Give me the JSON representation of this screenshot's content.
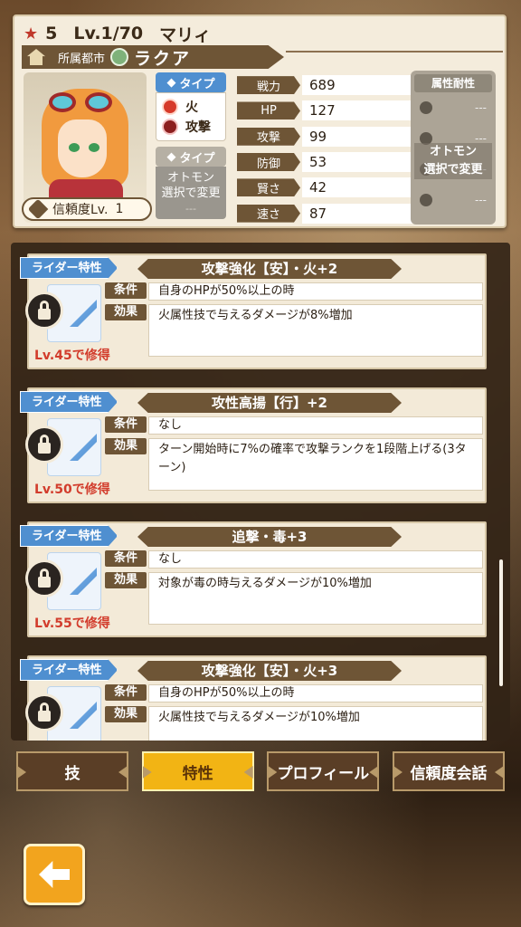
{
  "character": {
    "rarity": "5",
    "level": "Lv.1/70",
    "name": "マリィ",
    "city_label": "所属都市",
    "city_name": "ラクア",
    "trust_label": "信頼度Lv.",
    "trust_level": "1"
  },
  "type_panel": {
    "type_label": "タイプ",
    "element": "火",
    "style": "攻撃",
    "otomon_type_label": "タイプ",
    "otomon_text_line1": "オトモン",
    "otomon_text_line2": "選択で変更",
    "otomon_dash": "---"
  },
  "stats": [
    {
      "label": "戦力",
      "value": "689"
    },
    {
      "label": "HP",
      "value": "127"
    },
    {
      "label": "攻撃",
      "value": "99"
    },
    {
      "label": "防御",
      "value": "53"
    },
    {
      "label": "賢さ",
      "value": "42"
    },
    {
      "label": "速さ",
      "value": "87"
    }
  ],
  "resistance": {
    "title": "属性耐性",
    "dash": "---",
    "note_line1": "オトモン",
    "note_line2": "選択で変更"
  },
  "traits": [
    {
      "rider_label": "ライダー特性",
      "name": "攻撃強化【安】・火+2",
      "cond_label": "条件",
      "condition": "自身のHPが50%以上の時",
      "eff_label": "効果",
      "effect": "火属性技で与えるダメージが8%増加",
      "requirement": "Lv.45で修得"
    },
    {
      "rider_label": "ライダー特性",
      "name": "攻性高揚【行】+2",
      "cond_label": "条件",
      "condition": "なし",
      "eff_label": "効果",
      "effect": "ターン開始時に7%の確率で攻撃ランクを1段階上げる(3ターン)",
      "requirement": "Lv.50で修得"
    },
    {
      "rider_label": "ライダー特性",
      "name": "追撃・毒+3",
      "cond_label": "条件",
      "condition": "なし",
      "eff_label": "効果",
      "effect": "対象が毒の時与えるダメージが10%増加",
      "requirement": "Lv.55で修得"
    },
    {
      "rider_label": "ライダー特性",
      "name": "攻撃強化【安】・火+3",
      "cond_label": "条件",
      "condition": "自身のHPが50%以上の時",
      "eff_label": "効果",
      "effect": "火属性技で与えるダメージが10%増加",
      "requirement": ""
    }
  ],
  "tabs": [
    {
      "label": "技",
      "active": false
    },
    {
      "label": "特性",
      "active": true
    },
    {
      "label": "プロフィール",
      "active": false
    },
    {
      "label": "信頼度会話",
      "active": false
    }
  ],
  "colors": {
    "accent_blue": "#4f8fd0",
    "active_tab": "#f2b414",
    "panel_brown": "#6e5536",
    "locked_text": "#d23c2c"
  },
  "icons": {
    "rarity": "star-icon",
    "element": "fire-icon",
    "style": "attack-icon",
    "back": "back-arrow-icon"
  }
}
